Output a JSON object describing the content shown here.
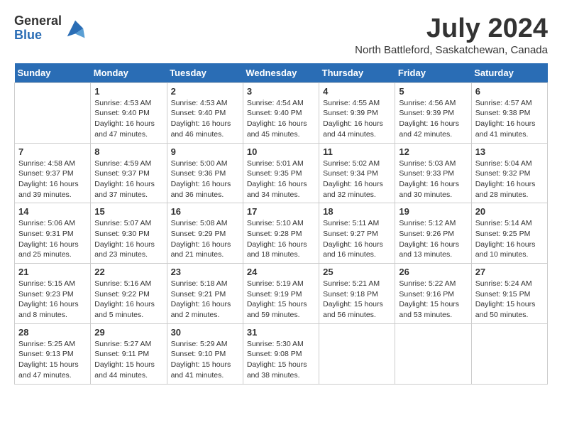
{
  "logo": {
    "general": "General",
    "blue": "Blue"
  },
  "title": {
    "month_year": "July 2024",
    "location": "North Battleford, Saskatchewan, Canada"
  },
  "weekdays": [
    "Sunday",
    "Monday",
    "Tuesday",
    "Wednesday",
    "Thursday",
    "Friday",
    "Saturday"
  ],
  "weeks": [
    [
      {
        "day": "",
        "info": ""
      },
      {
        "day": "1",
        "info": "Sunrise: 4:53 AM\nSunset: 9:40 PM\nDaylight: 16 hours\nand 47 minutes."
      },
      {
        "day": "2",
        "info": "Sunrise: 4:53 AM\nSunset: 9:40 PM\nDaylight: 16 hours\nand 46 minutes."
      },
      {
        "day": "3",
        "info": "Sunrise: 4:54 AM\nSunset: 9:40 PM\nDaylight: 16 hours\nand 45 minutes."
      },
      {
        "day": "4",
        "info": "Sunrise: 4:55 AM\nSunset: 9:39 PM\nDaylight: 16 hours\nand 44 minutes."
      },
      {
        "day": "5",
        "info": "Sunrise: 4:56 AM\nSunset: 9:39 PM\nDaylight: 16 hours\nand 42 minutes."
      },
      {
        "day": "6",
        "info": "Sunrise: 4:57 AM\nSunset: 9:38 PM\nDaylight: 16 hours\nand 41 minutes."
      }
    ],
    [
      {
        "day": "7",
        "info": "Sunrise: 4:58 AM\nSunset: 9:37 PM\nDaylight: 16 hours\nand 39 minutes."
      },
      {
        "day": "8",
        "info": "Sunrise: 4:59 AM\nSunset: 9:37 PM\nDaylight: 16 hours\nand 37 minutes."
      },
      {
        "day": "9",
        "info": "Sunrise: 5:00 AM\nSunset: 9:36 PM\nDaylight: 16 hours\nand 36 minutes."
      },
      {
        "day": "10",
        "info": "Sunrise: 5:01 AM\nSunset: 9:35 PM\nDaylight: 16 hours\nand 34 minutes."
      },
      {
        "day": "11",
        "info": "Sunrise: 5:02 AM\nSunset: 9:34 PM\nDaylight: 16 hours\nand 32 minutes."
      },
      {
        "day": "12",
        "info": "Sunrise: 5:03 AM\nSunset: 9:33 PM\nDaylight: 16 hours\nand 30 minutes."
      },
      {
        "day": "13",
        "info": "Sunrise: 5:04 AM\nSunset: 9:32 PM\nDaylight: 16 hours\nand 28 minutes."
      }
    ],
    [
      {
        "day": "14",
        "info": "Sunrise: 5:06 AM\nSunset: 9:31 PM\nDaylight: 16 hours\nand 25 minutes."
      },
      {
        "day": "15",
        "info": "Sunrise: 5:07 AM\nSunset: 9:30 PM\nDaylight: 16 hours\nand 23 minutes."
      },
      {
        "day": "16",
        "info": "Sunrise: 5:08 AM\nSunset: 9:29 PM\nDaylight: 16 hours\nand 21 minutes."
      },
      {
        "day": "17",
        "info": "Sunrise: 5:10 AM\nSunset: 9:28 PM\nDaylight: 16 hours\nand 18 minutes."
      },
      {
        "day": "18",
        "info": "Sunrise: 5:11 AM\nSunset: 9:27 PM\nDaylight: 16 hours\nand 16 minutes."
      },
      {
        "day": "19",
        "info": "Sunrise: 5:12 AM\nSunset: 9:26 PM\nDaylight: 16 hours\nand 13 minutes."
      },
      {
        "day": "20",
        "info": "Sunrise: 5:14 AM\nSunset: 9:25 PM\nDaylight: 16 hours\nand 10 minutes."
      }
    ],
    [
      {
        "day": "21",
        "info": "Sunrise: 5:15 AM\nSunset: 9:23 PM\nDaylight: 16 hours\nand 8 minutes."
      },
      {
        "day": "22",
        "info": "Sunrise: 5:16 AM\nSunset: 9:22 PM\nDaylight: 16 hours\nand 5 minutes."
      },
      {
        "day": "23",
        "info": "Sunrise: 5:18 AM\nSunset: 9:21 PM\nDaylight: 16 hours\nand 2 minutes."
      },
      {
        "day": "24",
        "info": "Sunrise: 5:19 AM\nSunset: 9:19 PM\nDaylight: 15 hours\nand 59 minutes."
      },
      {
        "day": "25",
        "info": "Sunrise: 5:21 AM\nSunset: 9:18 PM\nDaylight: 15 hours\nand 56 minutes."
      },
      {
        "day": "26",
        "info": "Sunrise: 5:22 AM\nSunset: 9:16 PM\nDaylight: 15 hours\nand 53 minutes."
      },
      {
        "day": "27",
        "info": "Sunrise: 5:24 AM\nSunset: 9:15 PM\nDaylight: 15 hours\nand 50 minutes."
      }
    ],
    [
      {
        "day": "28",
        "info": "Sunrise: 5:25 AM\nSunset: 9:13 PM\nDaylight: 15 hours\nand 47 minutes."
      },
      {
        "day": "29",
        "info": "Sunrise: 5:27 AM\nSunset: 9:11 PM\nDaylight: 15 hours\nand 44 minutes."
      },
      {
        "day": "30",
        "info": "Sunrise: 5:29 AM\nSunset: 9:10 PM\nDaylight: 15 hours\nand 41 minutes."
      },
      {
        "day": "31",
        "info": "Sunrise: 5:30 AM\nSunset: 9:08 PM\nDaylight: 15 hours\nand 38 minutes."
      },
      {
        "day": "",
        "info": ""
      },
      {
        "day": "",
        "info": ""
      },
      {
        "day": "",
        "info": ""
      }
    ]
  ]
}
